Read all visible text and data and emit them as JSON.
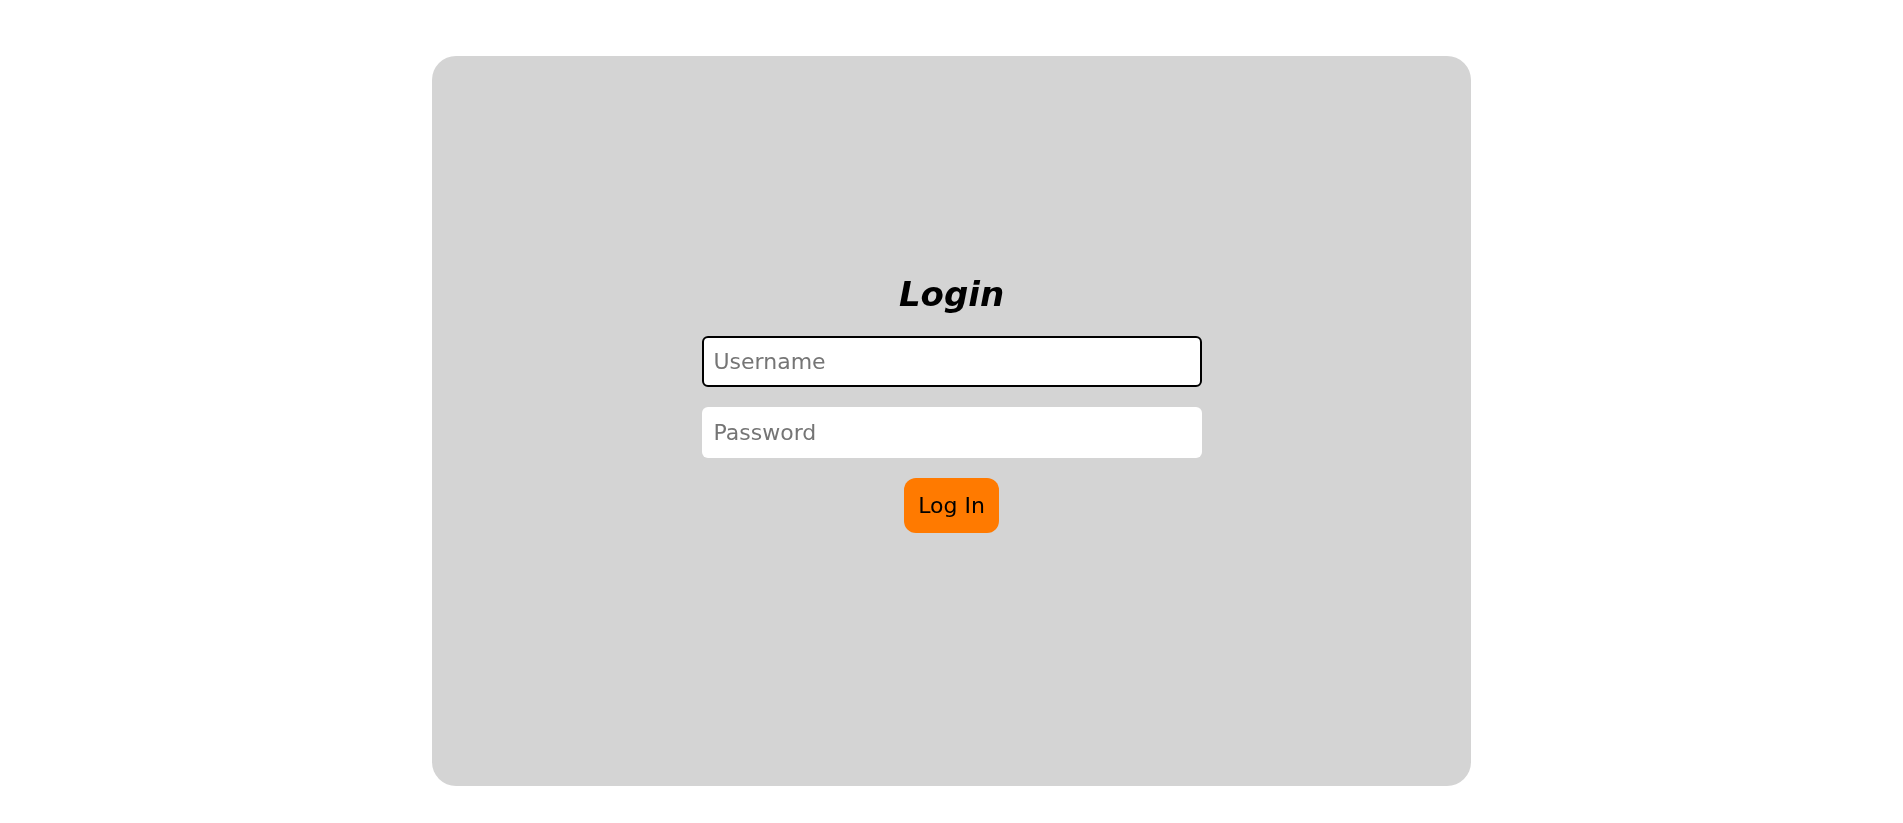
{
  "title": "Login",
  "fields": [
    {
      "placeholder": "Username",
      "focused": true
    },
    {
      "placeholder": "Password",
      "focused": false
    }
  ],
  "button": "Log In"
}
